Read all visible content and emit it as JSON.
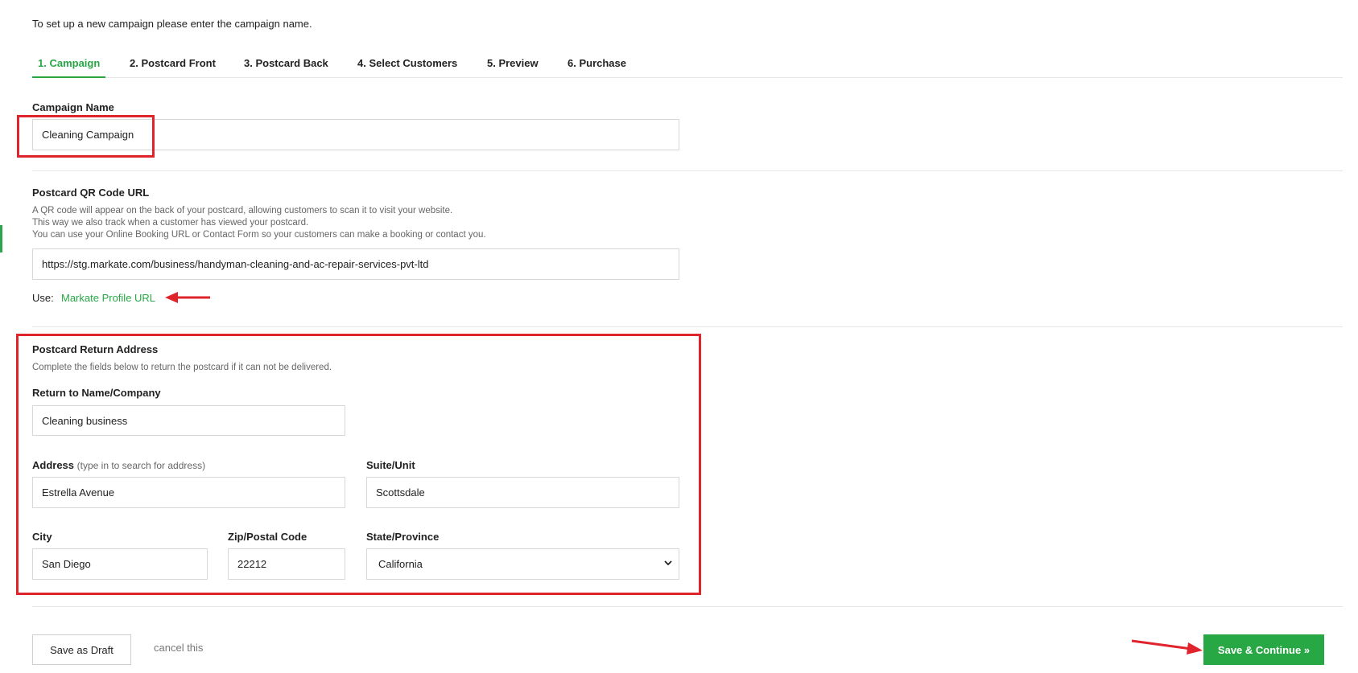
{
  "intro_text": "To set up a new campaign please enter the campaign name.",
  "tabs": [
    {
      "label": "1. Campaign",
      "active": true
    },
    {
      "label": "2. Postcard Front",
      "active": false
    },
    {
      "label": "3. Postcard Back",
      "active": false
    },
    {
      "label": "4. Select Customers",
      "active": false
    },
    {
      "label": "5. Preview",
      "active": false
    },
    {
      "label": "6. Purchase",
      "active": false
    }
  ],
  "campaign": {
    "label": "Campaign Name",
    "value": "Cleaning Campaign"
  },
  "qr": {
    "label": "Postcard QR Code URL",
    "help_lines": [
      "A QR code will appear on the back of your postcard, allowing customers to scan it to visit your website.",
      "This way we also track when a customer has viewed your postcard.",
      "You can use your Online Booking URL or Contact Form so your customers can make a booking or contact you."
    ],
    "value": "https://stg.markate.com/business/handyman-cleaning-and-ac-repair-services-pvt-ltd",
    "use_label": "Use:",
    "use_link": "Markate Profile URL"
  },
  "return_address": {
    "title": "Postcard Return Address",
    "help": "Complete the fields below to return the postcard if it can not be delivered.",
    "name_label": "Return to Name/Company",
    "name_value": "Cleaning business",
    "address_label": "Address",
    "address_hint": "(type in to search for address)",
    "address_value": "Estrella Avenue",
    "suite_label": "Suite/Unit",
    "suite_value": "Scottsdale",
    "city_label": "City",
    "city_value": "San Diego",
    "zip_label": "Zip/Postal Code",
    "zip_value": "22212",
    "state_label": "State/Province",
    "state_value": "California"
  },
  "footer": {
    "draft_label": "Save as Draft",
    "cancel_label": "cancel this",
    "save_label": "Save & Continue »"
  },
  "colors": {
    "accent": "#28a745",
    "annotation": "#e0242b"
  }
}
